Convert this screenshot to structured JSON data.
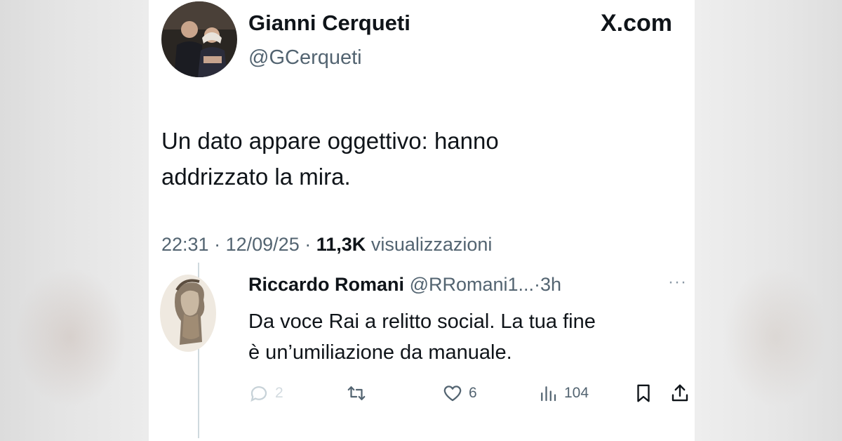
{
  "tweet": {
    "author_name": "Gianni Cerqueti",
    "author_handle": "@GCerqueti",
    "platform_logo": "X.com",
    "text_line1": "Un dato appare oggettivo: hanno",
    "text_line2": "addrizzato la mira.",
    "time": "22:31",
    "separator": "·",
    "date": "12/09/25",
    "views": "11,3K",
    "views_label": "visualizzazioni"
  },
  "reply": {
    "author_name": "Riccardo Romani",
    "author_handle": "@RRomani1...",
    "time": "·3h",
    "more": "···",
    "text_line1": "Da voce Rai a relitto social. La tua fine",
    "text_line2": "è un’umiliazione da manuale.",
    "actions": {
      "reply_count": "2",
      "like_count": "6",
      "views_count": "104"
    }
  },
  "icons": {
    "reply": "comment-icon",
    "retweet": "retweet-icon",
    "like": "heart-icon",
    "views": "analytics-icon",
    "bookmark": "bookmark-icon",
    "share": "share-icon"
  },
  "colors": {
    "text_primary": "#0f1419",
    "text_secondary": "#536471",
    "thread_line": "#cfd9de"
  }
}
